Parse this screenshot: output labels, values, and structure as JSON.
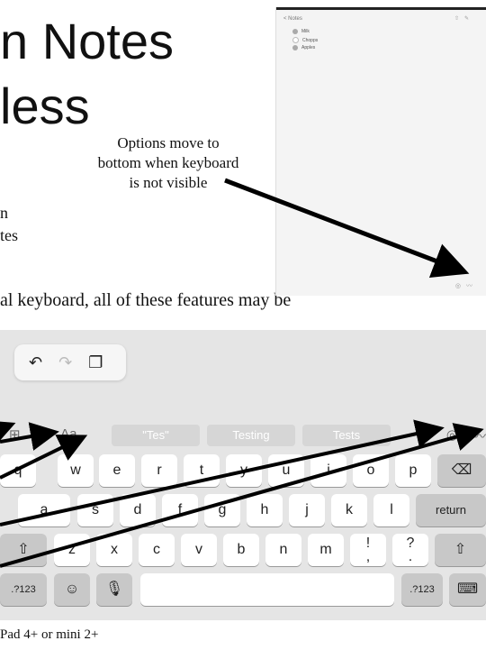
{
  "slide": {
    "title_line1": "n Notes",
    "title_line2": "less",
    "bullet_line1": "n",
    "bullet_line2": "tes",
    "callout": "Options move to bottom when keyboard is not visible",
    "line3": "al keyboard, all of these features may be",
    "caption": "Pad 4+ or mini 2+"
  },
  "ipad_screen": {
    "back_label": "< Notes",
    "items": [
      "Milk",
      "Chopps",
      "Apples"
    ]
  },
  "keyboard": {
    "undo_icons": [
      "undo-icon",
      "redo-icon",
      "paste-icon"
    ],
    "left_toolbar": {
      "table": "⊞",
      "checklist": "⊘",
      "format": "Aa"
    },
    "suggestions": [
      "\"Tes\"",
      "Testing",
      "Tests"
    ],
    "right_toolbar": {
      "camera": "◎",
      "sketch": "〰"
    },
    "row1": [
      "q",
      "w",
      "e",
      "r",
      "t",
      "y",
      "u",
      "i",
      "o",
      "p"
    ],
    "row2": [
      "a",
      "s",
      "d",
      "f",
      "g",
      "h",
      "j",
      "k",
      "l"
    ],
    "row3": [
      "z",
      "x",
      "c",
      "v",
      "b",
      "n",
      "m"
    ],
    "punct1": "!",
    "punct1_sub": ",",
    "punct2": "?",
    "punct2_sub": ".",
    "return_label": "return",
    "numbers_label": ".?123"
  }
}
